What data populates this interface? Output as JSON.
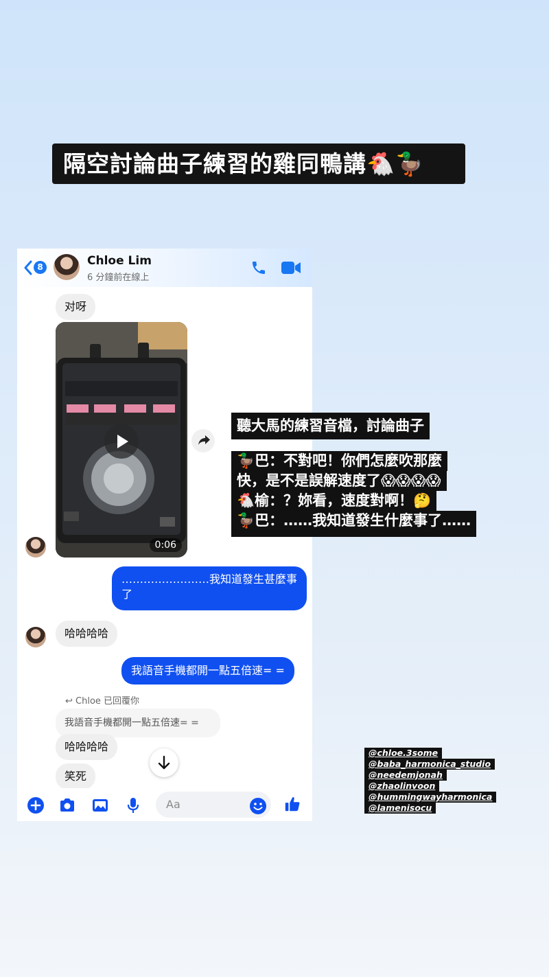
{
  "story": {
    "title": "隔空討論曲子練習的雞同鴨講🐔🦆",
    "caption_top": "聽大馬的練習音檔，討論曲子",
    "caption_lines": [
      "🦆巴：不對吧！你們怎麼吹那麼",
      "快，是不是誤解速度了😱😱😱😱",
      "🐔榆：？妳看，速度對啊！🤔",
      "🦆巴：……我知道發生什麼事了……"
    ],
    "tags": [
      "@chloe.3some",
      "@baba_harmonica_studio",
      "@needemjonah",
      "@zhaolinvoon",
      "@hummingwayharmonica",
      "@lamenisocu"
    ]
  },
  "chat": {
    "back_badge": "8",
    "contact_name": "Chloe Lim",
    "contact_status": "6 分鐘前在線上",
    "messages": {
      "m1": "对呀",
      "video_duration": "0:06",
      "m2": "……………………我知道發生甚麼事了",
      "m3": "哈哈哈哈",
      "m4": "我語音手機都開一點五倍速= =",
      "reply_label": "Chloe 已回覆你",
      "reply_quote": "我語音手機都開一點五倍速= =",
      "m5": "哈哈哈哈",
      "m6": "笑死"
    },
    "composer_placeholder": "Aa",
    "accent_color": "#1050f0"
  }
}
